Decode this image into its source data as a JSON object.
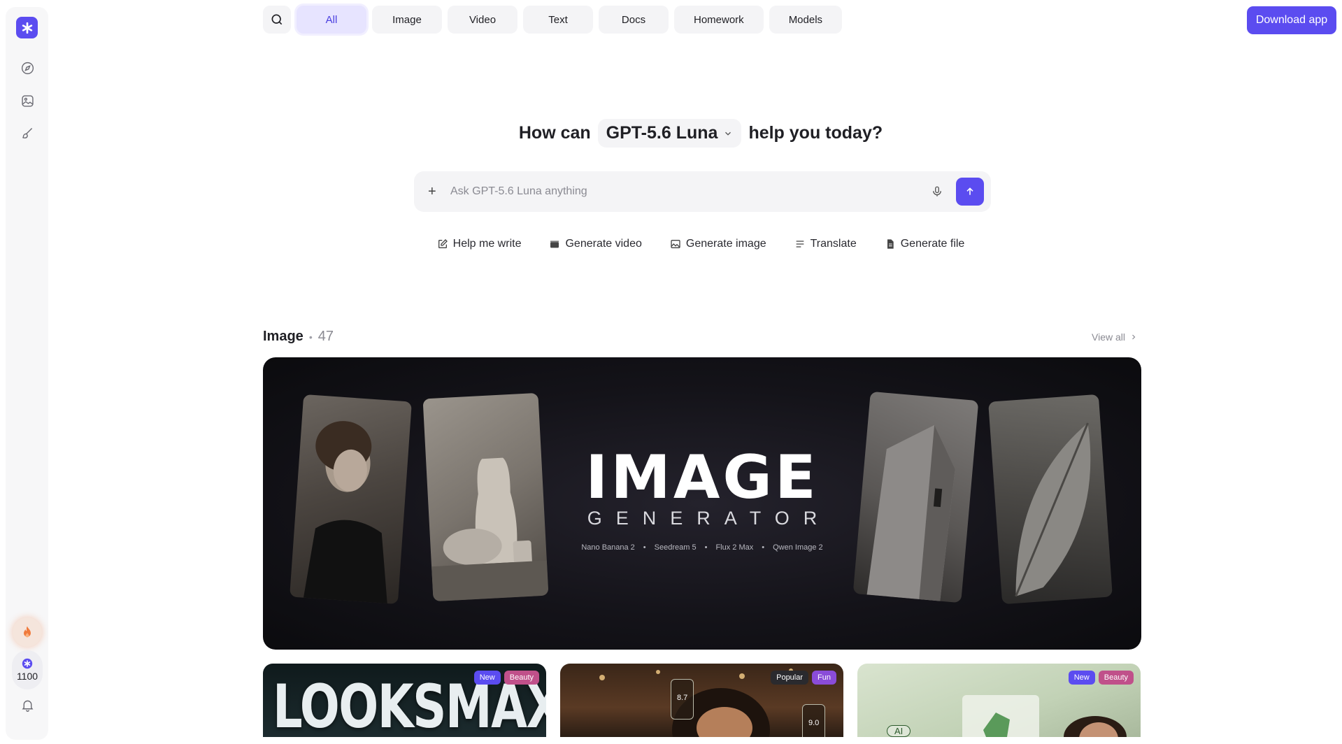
{
  "sidebar": {
    "credits": "1100"
  },
  "nav": {
    "tabs": [
      {
        "label": "All",
        "active": true
      },
      {
        "label": "Image",
        "active": false
      },
      {
        "label": "Video",
        "active": false
      },
      {
        "label": "Text",
        "active": false
      },
      {
        "label": "Docs",
        "active": false
      },
      {
        "label": "Homework",
        "active": false
      },
      {
        "label": "Models",
        "active": false
      }
    ],
    "download_label": "Download app"
  },
  "hero": {
    "prefix": "How can",
    "model": "GPT-5.6 Luna",
    "suffix": "help you today?"
  },
  "composer": {
    "placeholder": "Ask GPT-5.6 Luna anything"
  },
  "actions": [
    {
      "label": "Help me write",
      "icon": "pencil-square-icon"
    },
    {
      "label": "Generate video",
      "icon": "clapperboard-icon"
    },
    {
      "label": "Generate image",
      "icon": "image-icon"
    },
    {
      "label": "Translate",
      "icon": "lines-icon"
    },
    {
      "label": "Generate file",
      "icon": "file-icon"
    }
  ],
  "section": {
    "title": "Image",
    "count": "47",
    "view_all": "View all"
  },
  "banner": {
    "title": "IMAGE",
    "subtitle": "GENERATOR",
    "models": [
      "Nano Banana 2",
      "Seedream 5",
      "Flux 2 Max",
      "Qwen Image 2"
    ]
  },
  "cards": [
    {
      "tags": [
        "New",
        "Beauty"
      ],
      "art_text": "LOOKSMAX"
    },
    {
      "tags": [
        "Popular",
        "Fun"
      ],
      "scores": [
        "8.7",
        "9.0"
      ]
    },
    {
      "tags": [
        "New",
        "Beauty"
      ],
      "badge": "AI"
    }
  ],
  "colors": {
    "accent": "#5b4cf0",
    "active_tab_bg": "#e7e4ff"
  }
}
